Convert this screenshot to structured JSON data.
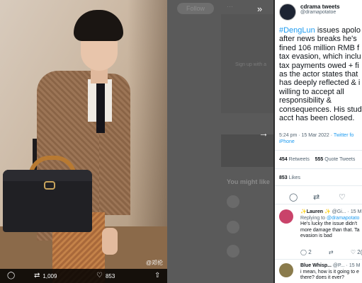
{
  "background": {
    "follow_label": "Follow",
    "sign_up_label": "Sign up with a",
    "you_might_like": "You might like"
  },
  "photo": {
    "watermark": "@邓伦",
    "actions": {
      "reply_count": "",
      "retweet_count": "1,009",
      "like_count": "853"
    }
  },
  "controls": {
    "expand_icon": "double-chevron-right",
    "next_icon": "arrow-right"
  },
  "tweet": {
    "author_name": "cdrama tweets",
    "author_handle": "@dramapotatoe",
    "hashtag": "#DengLun",
    "text_first_line": " issues apolo",
    "text_rest": "after news breaks he's\nfined 106 million RMB f\ntax evasion, which inclu\ntax payments owed + fi\nas the actor states that\nhas deeply reflected & i\nwilling to accept all\nresponsibility &\nconsequences. His stud\nacct has been closed.",
    "timestamp": "5:24 pm · 15 Mar 2022 · ",
    "source": "Twitter fo",
    "source_line2": "iPhone",
    "retweets_count": "454",
    "retweets_label": "Retweets",
    "quotes_count": "555",
    "quotes_label": "Quote Tweets",
    "likes_count": "853",
    "likes_label": "Likes"
  },
  "replies": [
    {
      "name": "✨Lauren ✨",
      "handle": "@Gi... · 15 M",
      "replying_to_prefix": "Replying to ",
      "replying_to_handle": "@dramapotato",
      "text": "He's lucky the issue didn't\nmore damage than that. Ta\nevasion is bad",
      "reply_count": "2",
      "retweet_count": "",
      "like_count": "2("
    },
    {
      "name": "Blue Whisp...",
      "handle": "@P... · 15 M",
      "text": "i mean, how is it going to e\nthere? does it ever?"
    }
  ],
  "colors": {
    "accent": "#1d9bf0",
    "text": "#0f1419",
    "muted": "#536471"
  }
}
